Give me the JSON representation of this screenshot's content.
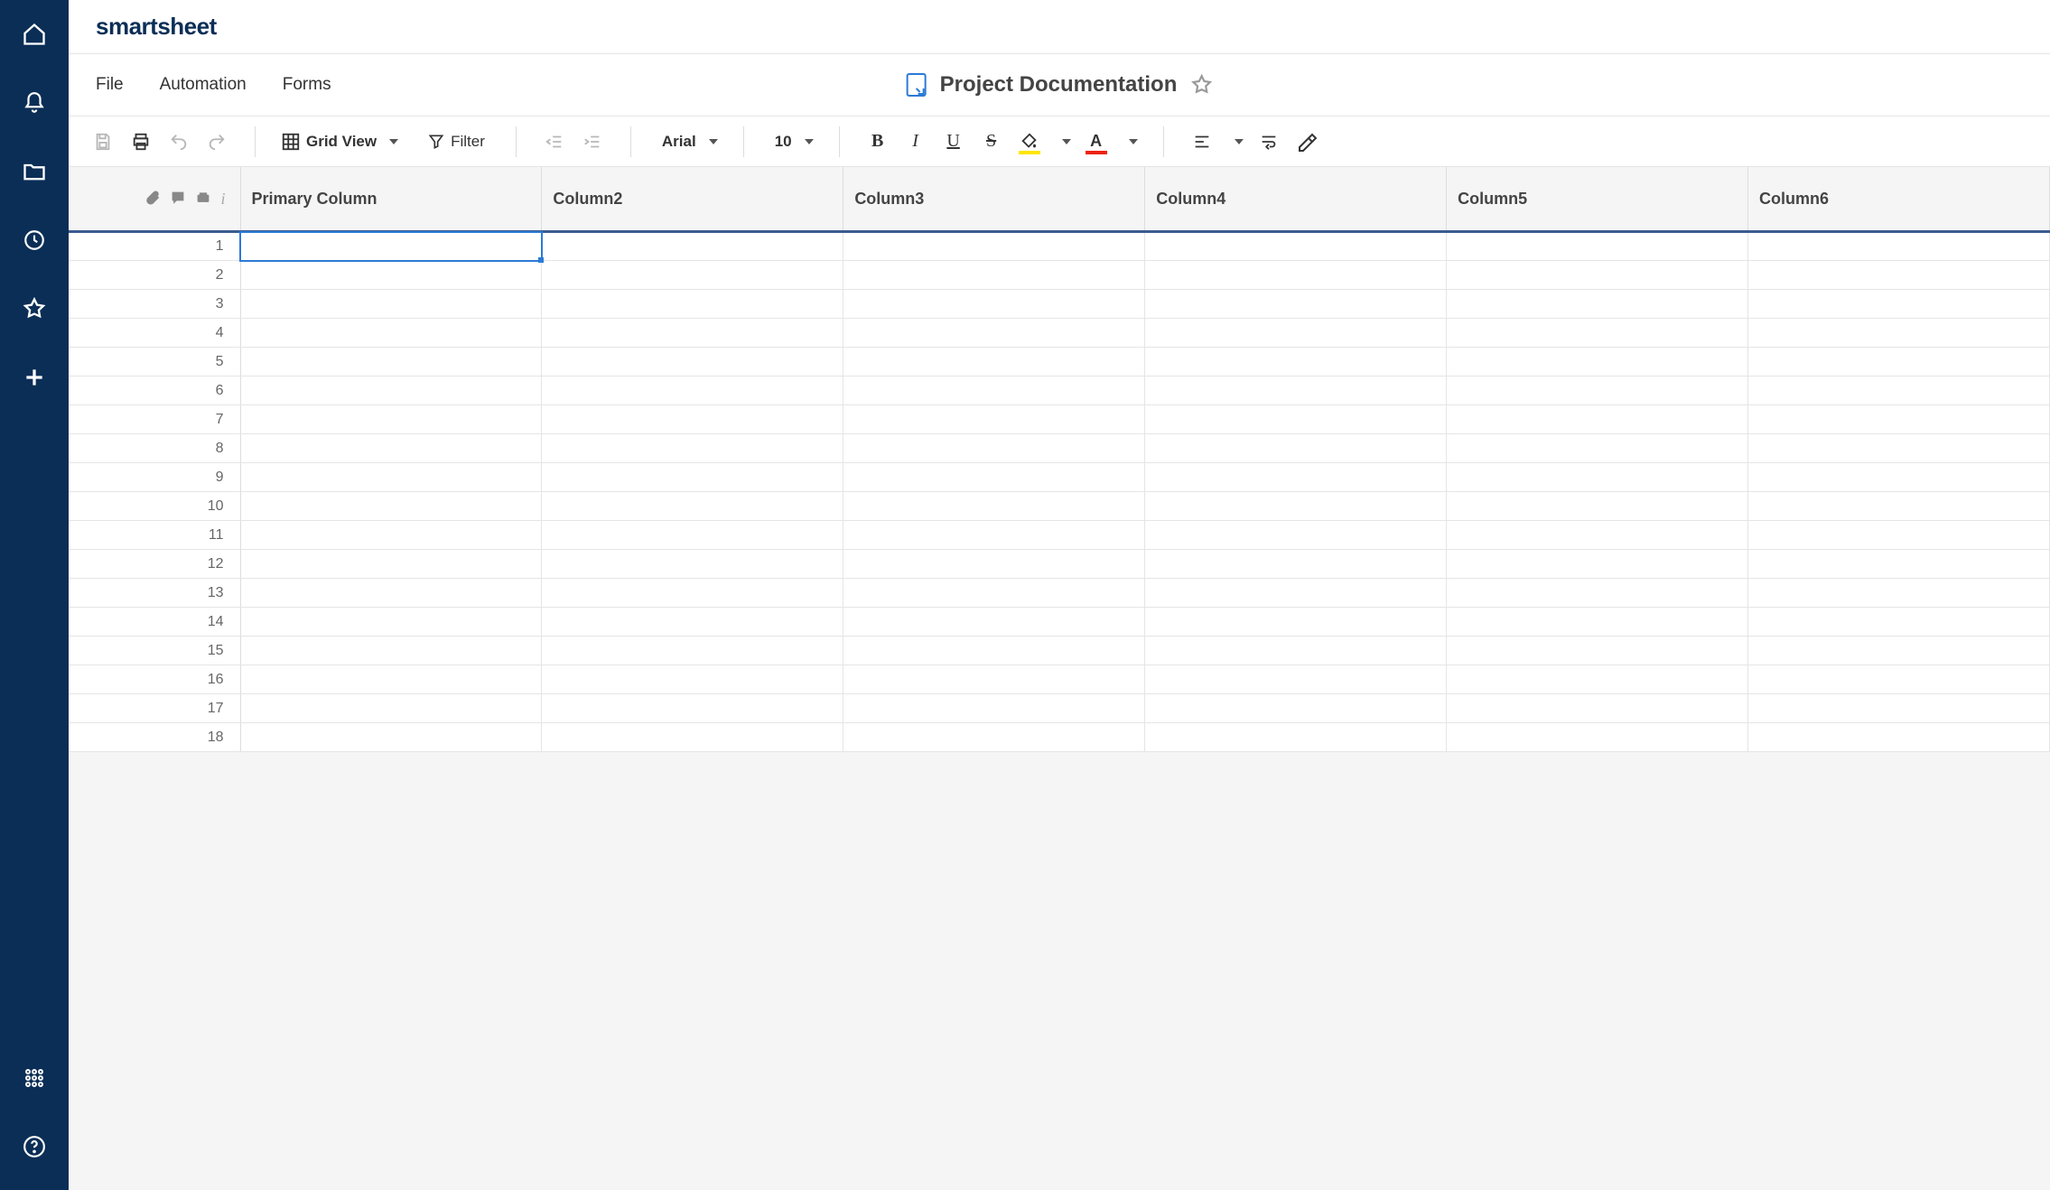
{
  "brand": "smartsheet",
  "menu": {
    "file": "File",
    "automation": "Automation",
    "forms": "Forms"
  },
  "sheet": {
    "title": "Project Documentation"
  },
  "toolbar": {
    "view_label": "Grid View",
    "filter_label": "Filter",
    "font_name": "Arial",
    "font_size": "10"
  },
  "columns": [
    "Primary Column",
    "Column2",
    "Column3",
    "Column4",
    "Column5",
    "Column6"
  ],
  "rows": [
    1,
    2,
    3,
    4,
    5,
    6,
    7,
    8,
    9,
    10,
    11,
    12,
    13,
    14,
    15,
    16,
    17,
    18
  ],
  "selected_cell": {
    "row": 1,
    "col": 0
  }
}
